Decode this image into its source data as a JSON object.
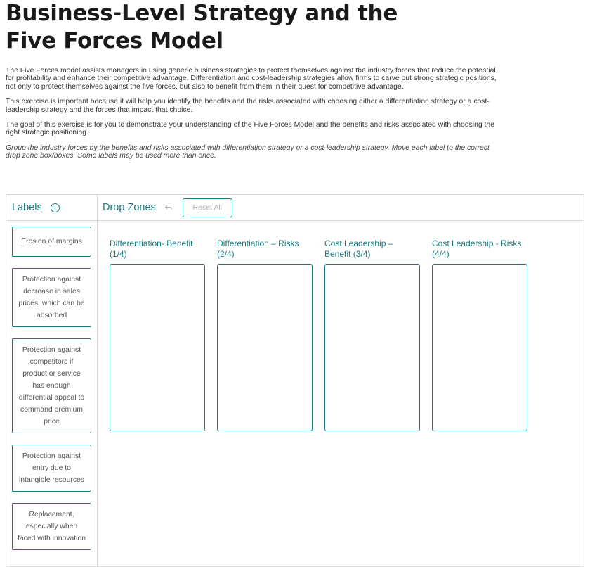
{
  "page": {
    "title": "Business-Level Strategy and the Five Forces Model",
    "paragraphs": [
      "The Five Forces model assists managers in using generic business strategies to protect themselves against the industry forces that reduce the potential for profitability and enhance their competitive advantage. Differentiation and cost-leadership strategies allow firms to carve out strong strategic positions, not only to protect themselves against the five forces, but also to benefit from them in their quest for competitive advantage.",
      "This exercise is important because it will help you identify the benefits and the risks associated with choosing either a differentiation strategy or a cost-leadership strategy and the forces that impact that choice.",
      "The goal of this exercise is for you to demonstrate your understanding of the Five Forces Model and the benefits and risks associated with choosing the right strategic positioning."
    ],
    "instructions": "Group the industry forces by the benefits and risks associated with differentiation strategy or a cost-leadership strategy. Move each label to the correct drop zone box/boxes. Some labels may be used more than once."
  },
  "labels_panel": {
    "title": "Labels",
    "info_icon": "info-icon",
    "items": [
      "Erosion of margins",
      "Protection against decrease in sales prices, which can be absorbed",
      "Protection against competitors if product or service has enough differential appeal to command premium price",
      "Protection against entry due to intangible resources",
      "Replacement, especially when faced with innovation"
    ]
  },
  "zones_panel": {
    "title": "Drop Zones",
    "undo_icon": "undo-icon",
    "reset_label": "Reset All",
    "zones": [
      "Differentiation- Benefit (1/4)",
      "Differentiation – Risks (2/4)",
      "Cost Leadership – Benefit (3/4)",
      "Cost Leadership - Risks (4/4)"
    ]
  },
  "colors": {
    "accent": "#1a7a80",
    "text": "#333333",
    "border": "#d8d8d8"
  }
}
